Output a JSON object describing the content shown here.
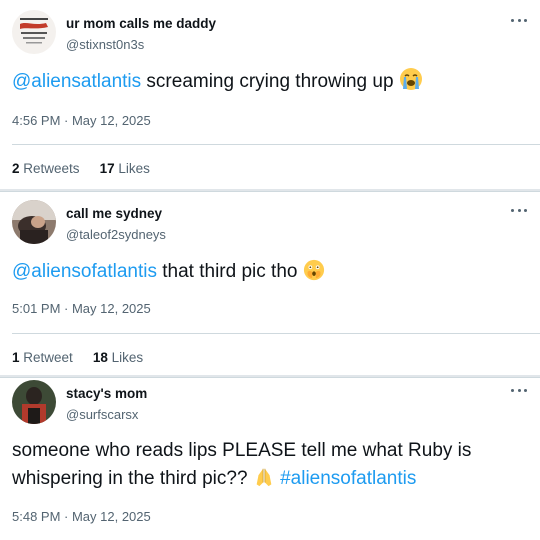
{
  "tweets": [
    {
      "display_name": "ur mom calls me daddy",
      "handle": "@stixnst0n3s",
      "mention": "@aliensatlantis",
      "body": " screaming crying throwing up",
      "emoji": "loudly-crying-emoji",
      "timestamp": "4:56 PM · May 12, 2025",
      "stats": [
        {
          "count": "2",
          "label": "Retweets"
        },
        {
          "count": "17",
          "label": "Likes"
        }
      ]
    },
    {
      "display_name": "call me sydney",
      "handle": "@taleof2sydneys",
      "mention": "@aliensofatlantis",
      "body": " that third pic tho",
      "emoji": "face-with-open-eyes-and-hand-over-mouth-emoji",
      "timestamp": "5:01 PM · May 12, 2025",
      "stats": [
        {
          "count": "1",
          "label": "Retweet"
        },
        {
          "count": "18",
          "label": "Likes"
        }
      ]
    },
    {
      "display_name": "stacy's mom",
      "handle": "@surfscarsx",
      "body_line1": "someone who reads lips PLEASE tell me what Ruby is",
      "body_line2": "whispering in the third pic??",
      "emoji": "folded-hands-emoji",
      "hashtag": "#aliensofatlantis",
      "timestamp": "5:48 PM · May 12, 2025"
    }
  ],
  "colors": {
    "link": "#1d9bf0",
    "secondary_text": "#536471",
    "primary_text": "#0f1419",
    "separator": "#e1e6ea"
  }
}
